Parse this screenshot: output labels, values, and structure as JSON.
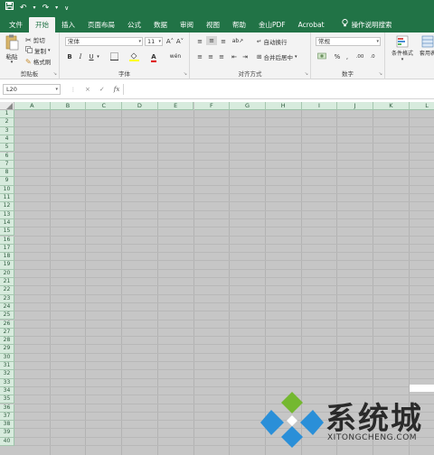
{
  "qat": {
    "save_icon": "save-icon",
    "undo_icon": "undo-icon",
    "redo_icon": "redo-icon",
    "more": "∨"
  },
  "tabs": [
    {
      "label": "文件"
    },
    {
      "label": "开始"
    },
    {
      "label": "插入"
    },
    {
      "label": "页面布局"
    },
    {
      "label": "公式"
    },
    {
      "label": "数据"
    },
    {
      "label": "审阅"
    },
    {
      "label": "视图"
    },
    {
      "label": "帮助"
    },
    {
      "label": "金山PDF"
    },
    {
      "label": "Acrobat"
    }
  ],
  "tellme": "操作说明搜索",
  "ribbon": {
    "clipboard": {
      "paste": "粘贴",
      "cut": "剪切",
      "copy": "复制",
      "format_painter": "格式刷",
      "group_label": "剪贴板"
    },
    "font": {
      "name": "宋体",
      "size": "11",
      "bold": "B",
      "italic": "I",
      "underline": "U",
      "grow": "A˄",
      "shrink": "A˅",
      "wen": "wén",
      "group_label": "字体"
    },
    "alignment": {
      "wrap": "自动换行",
      "merge": "合并后居中",
      "group_label": "对齐方式"
    },
    "number": {
      "format": "常规",
      "percent": "%",
      "comma": ",",
      "group_label": "数字"
    },
    "styles": {
      "conditional": "条件格式",
      "table": "套用表格格"
    }
  },
  "formula_bar": {
    "name_box": "L20",
    "cancel": "×",
    "enter": "✓",
    "fx": "fx",
    "value": ""
  },
  "columns": [
    "A",
    "B",
    "C",
    "D",
    "E",
    "F",
    "G",
    "H",
    "I",
    "J",
    "K",
    "L"
  ],
  "rows": [
    "1",
    "2",
    "3",
    "4",
    "5",
    "6",
    "7",
    "8",
    "9",
    "10",
    "11",
    "12",
    "13",
    "14",
    "15",
    "16",
    "17",
    "18",
    "19",
    "20",
    "21",
    "22",
    "23",
    "24",
    "25",
    "26",
    "27",
    "28",
    "29",
    "30",
    "31",
    "32",
    "33",
    "34",
    "35",
    "36",
    "37",
    "38",
    "39",
    "40"
  ],
  "watermark": {
    "text": "系统城",
    "sub": "XITONGCHENG.COM",
    "colors": [
      "#74b830",
      "#2a8fd8"
    ]
  }
}
